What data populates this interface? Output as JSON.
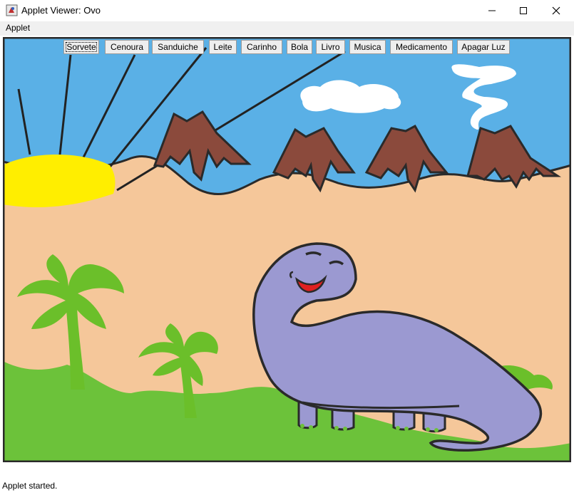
{
  "window": {
    "title": "Applet Viewer: Ovo",
    "icon": "java-applet-icon",
    "controls": [
      "minimize-icon",
      "maximize-icon",
      "close-icon"
    ]
  },
  "menu": {
    "applet_label": "Applet"
  },
  "toolbar": {
    "buttons": [
      "Sorvete",
      "Cenoura",
      "Sanduiche",
      "Leite",
      "Carinho",
      "Bola",
      "Livro",
      "Musica",
      "Medicamento",
      "Apagar Luz"
    ],
    "focused": "Sorvete"
  },
  "scene": {
    "description_icons": [
      "sun",
      "volcano",
      "volcano",
      "volcano",
      "volcano",
      "cloud",
      "smoke",
      "palm-tree",
      "palm-tree",
      "dinosaur"
    ],
    "colors": {
      "sky": "#5ab0e6",
      "sand": "#f5c79a",
      "sun": "#ffee00",
      "volcano": "#8b4a3c",
      "grass": "#6cc23a",
      "palm": "#6bbf2a",
      "dino": "#9b99d1",
      "mouth": "#e02020"
    }
  },
  "status": {
    "text": "Applet started."
  }
}
